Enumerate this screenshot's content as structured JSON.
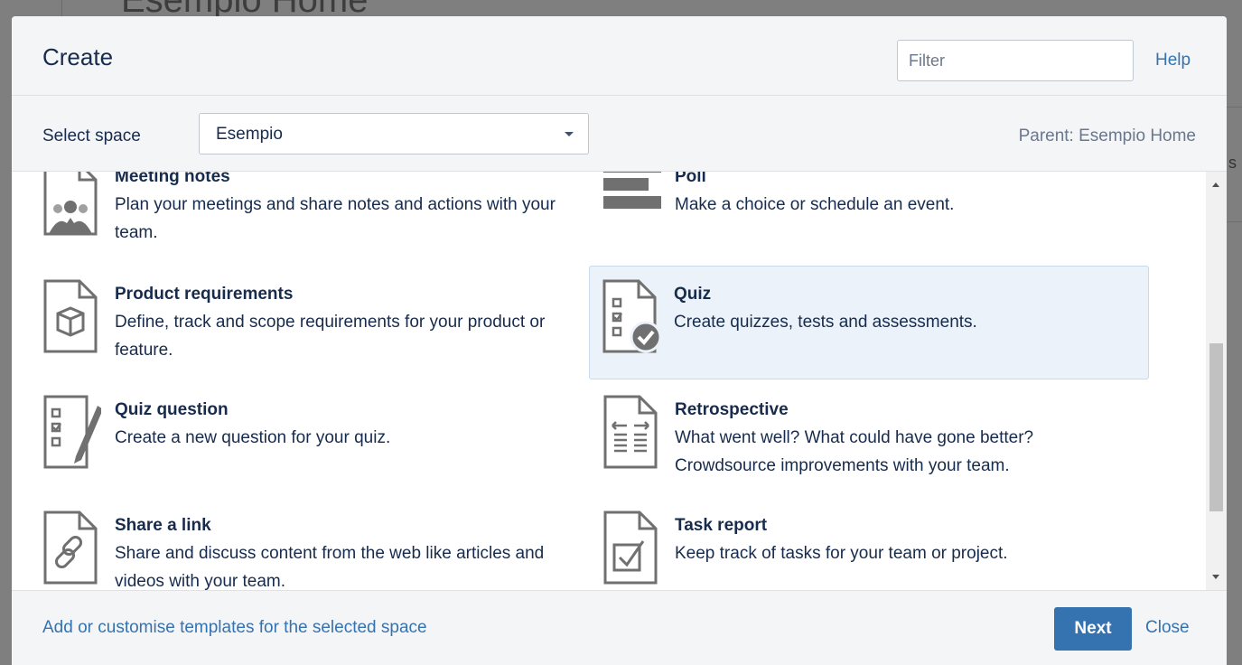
{
  "background": {
    "page_title": "Esempio Home"
  },
  "dialog": {
    "title": "Create",
    "filter_placeholder": "Filter",
    "help_label": "Help",
    "space_label": "Select space",
    "space_value": "Esempio",
    "parent_label": "Parent: Esempio Home"
  },
  "templates": [
    {
      "name": "Meeting notes",
      "description": "Plan your meetings and share notes and actions with your team.",
      "icon": "meeting-notes-icon"
    },
    {
      "name": "Poll",
      "description": "Make a choice or schedule an event.",
      "icon": "poll-icon"
    },
    {
      "name": "Product requirements",
      "description": "Define, track and scope requirements for your product or feature.",
      "icon": "product-requirements-icon"
    },
    {
      "name": "Quiz",
      "description": "Create quizzes, tests and assessments.",
      "icon": "quiz-icon",
      "selected": true
    },
    {
      "name": "Quiz question",
      "description": "Create a new question for your quiz.",
      "icon": "quiz-question-icon"
    },
    {
      "name": "Retrospective",
      "description": "What went well? What could have gone better? Crowdsource improvements with your team.",
      "icon": "retrospective-icon"
    },
    {
      "name": "Share a link",
      "description": "Share and discuss content from the web like articles and videos with your team.",
      "icon": "share-link-icon"
    },
    {
      "name": "Task report",
      "description": "Keep track of tasks for your team or project.",
      "icon": "task-report-icon"
    }
  ],
  "footer": {
    "templates_link": "Add or customise templates for the selected space",
    "next_label": "Next",
    "close_label": "Close"
  },
  "colors": {
    "accent": "#3572b0",
    "selected_bg": "#ebf2f9",
    "icon_gray": "#707070"
  }
}
